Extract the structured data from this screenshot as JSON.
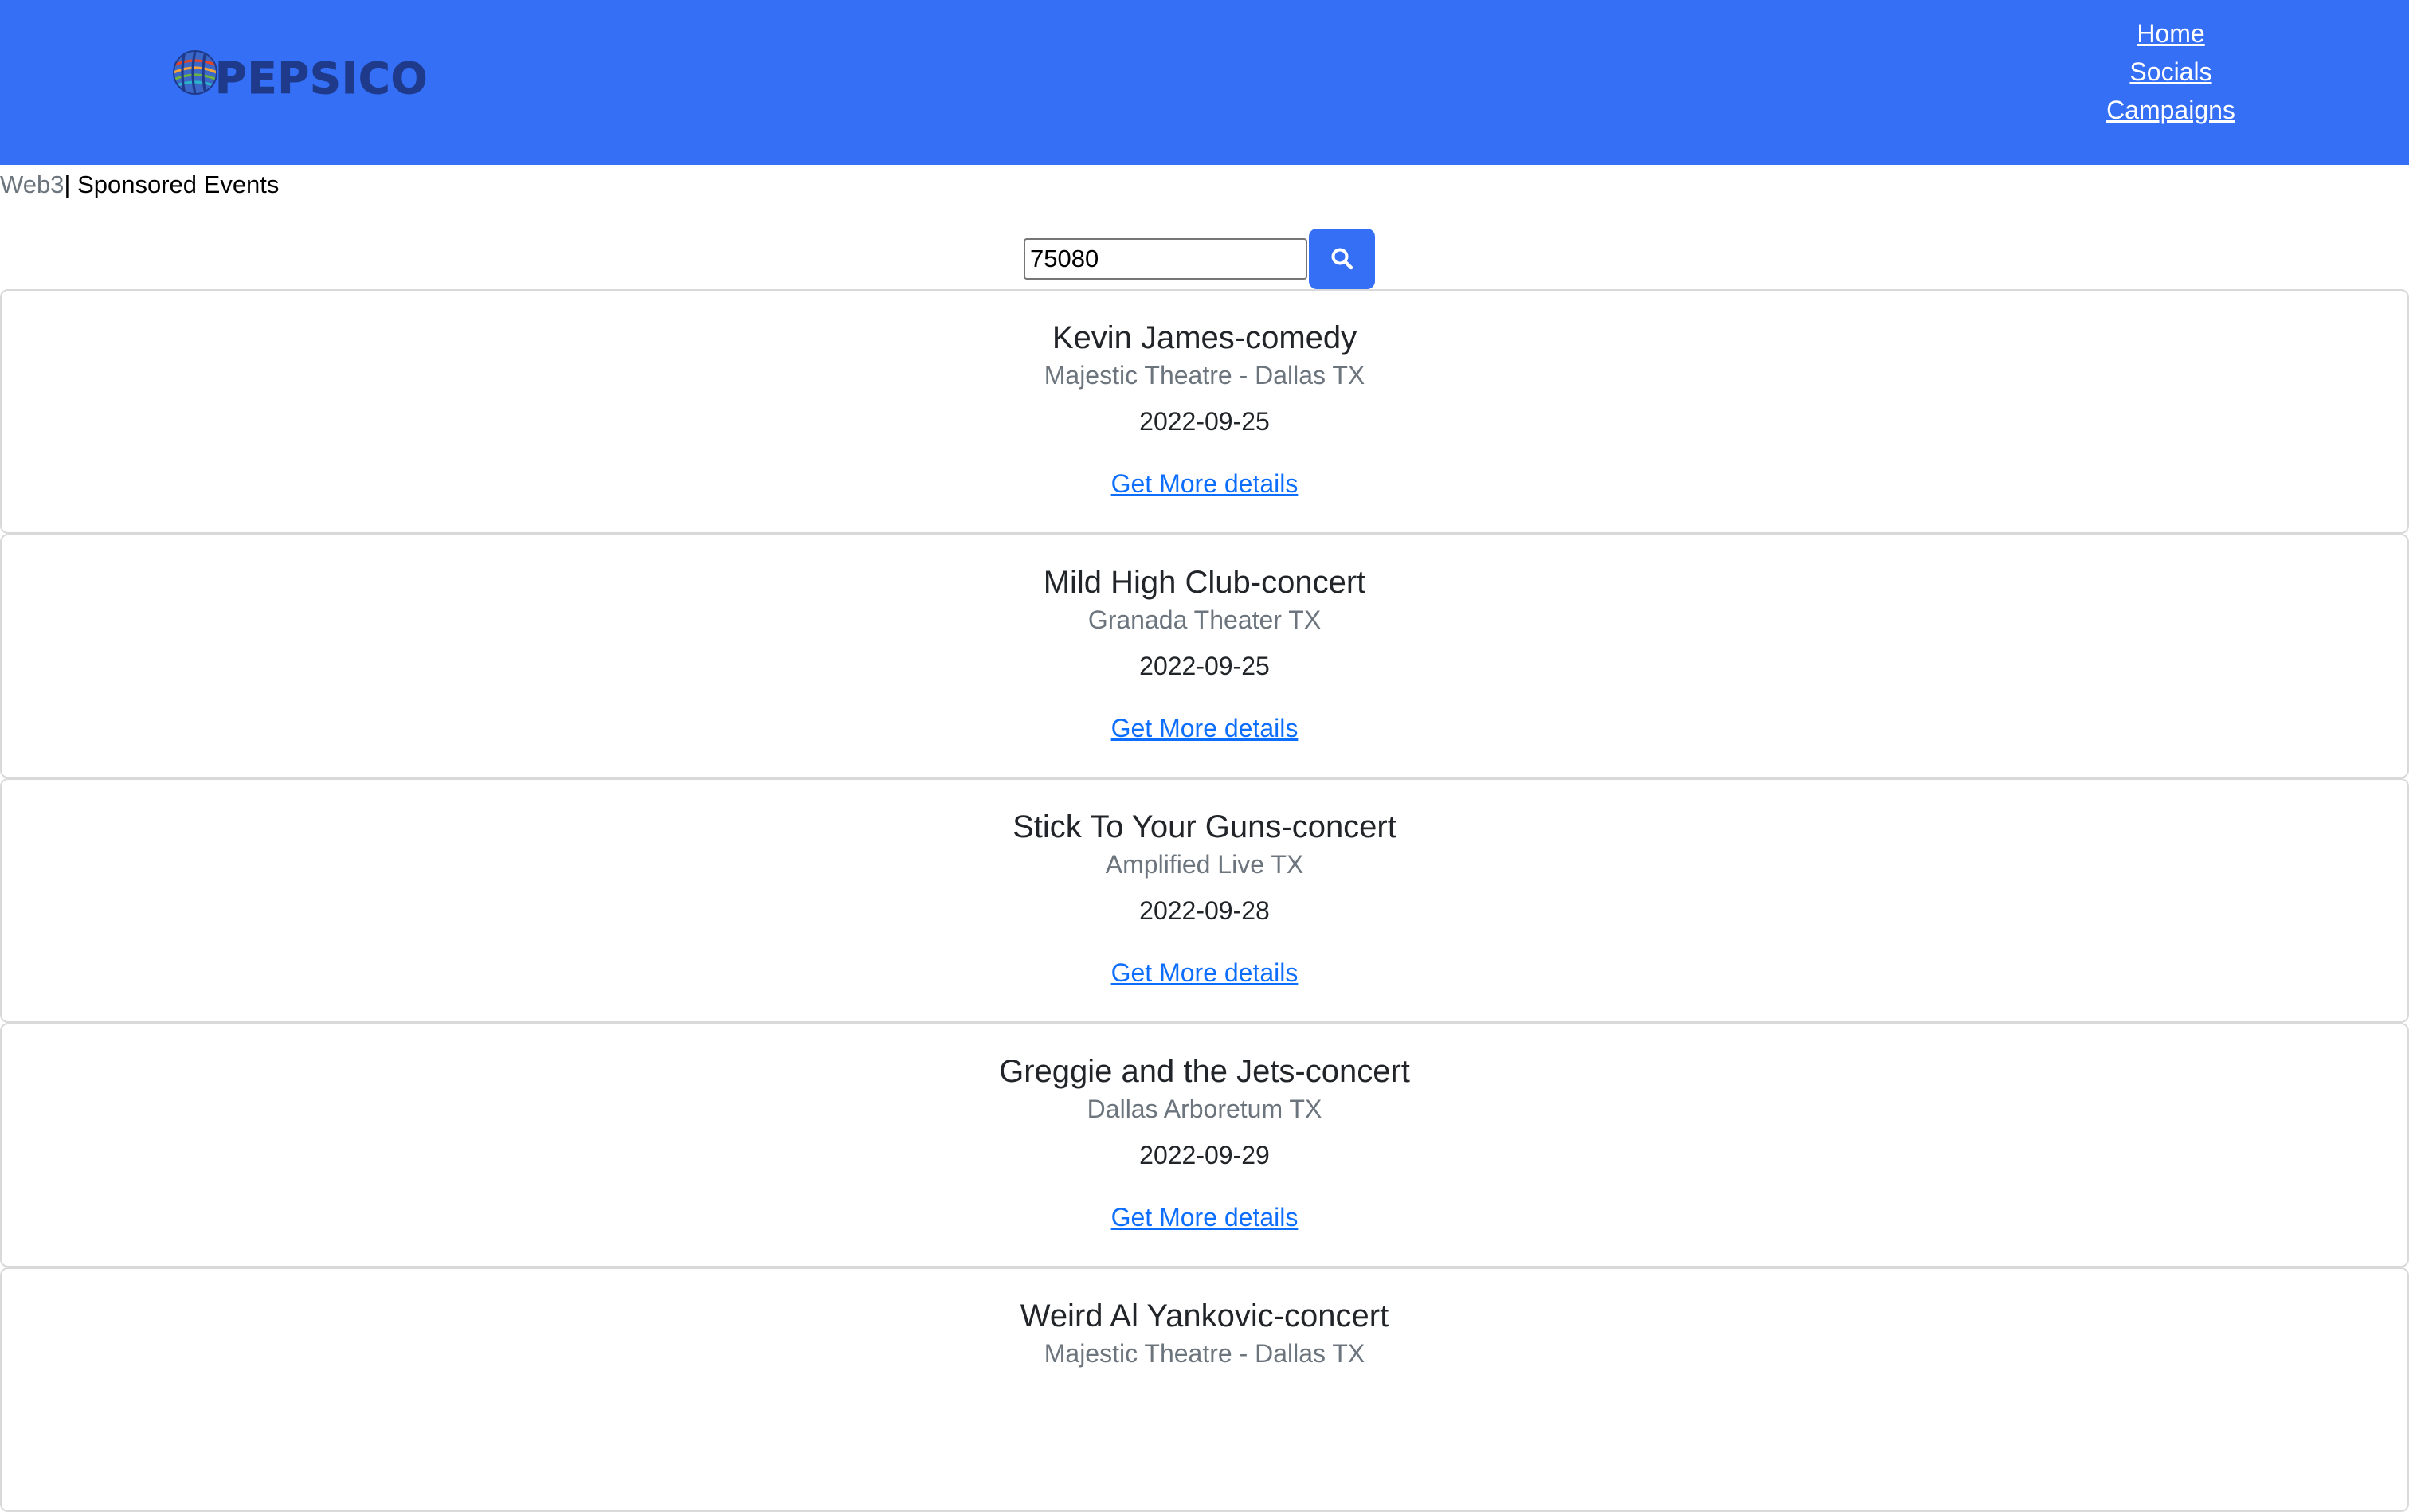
{
  "header": {
    "brand": "PEPSICO",
    "logo_icon": "pepsico-globe-icon",
    "background_color": "#346ff5",
    "nav": [
      "Home",
      "Socials",
      "Campaigns"
    ]
  },
  "breadcrumb": {
    "root": "Web3",
    "current": "| Sponsored Events"
  },
  "search": {
    "value": "75080",
    "icon": "search-icon",
    "button_color": "#346ff5"
  },
  "events": [
    {
      "title": "Kevin James-comedy",
      "venue": "Majestic Theatre - Dallas TX",
      "date": "2022-09-25",
      "link": "Get More details"
    },
    {
      "title": "Mild High Club-concert",
      "venue": "Granada Theater TX",
      "date": "2022-09-25",
      "link": "Get More details"
    },
    {
      "title": "Stick To Your Guns-concert",
      "venue": "Amplified Live TX",
      "date": "2022-09-28",
      "link": "Get More details"
    },
    {
      "title": "Greggie and the Jets-concert",
      "venue": "Dallas Arboretum TX",
      "date": "2022-09-29",
      "link": "Get More details"
    },
    {
      "title": "Weird Al Yankovic-concert",
      "venue": "Majestic Theatre - Dallas TX",
      "date": "",
      "link": ""
    }
  ]
}
